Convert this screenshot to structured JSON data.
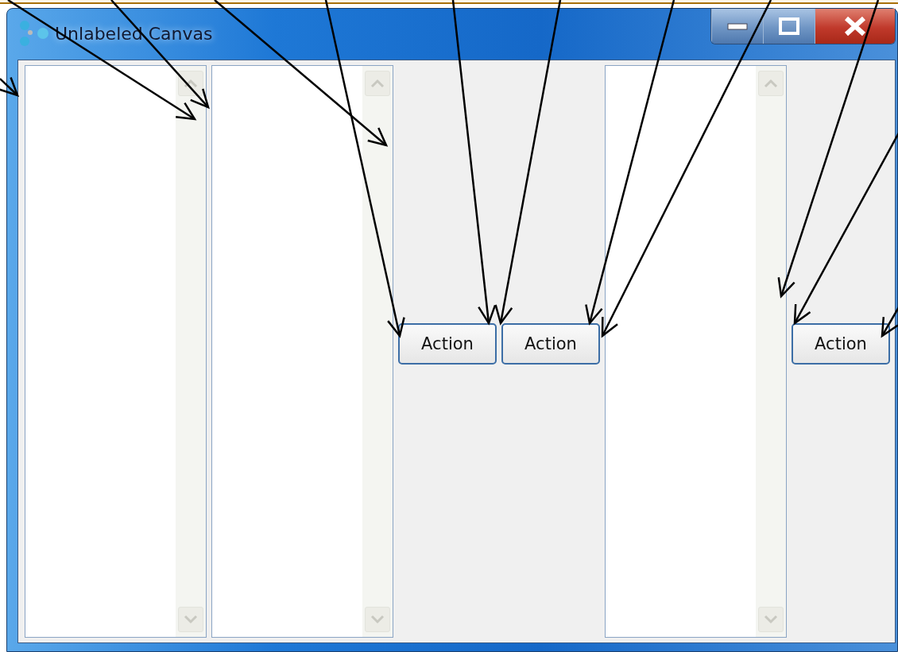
{
  "window": {
    "title": "Unlabeled Canvas"
  },
  "panes": [
    {
      "kind": "list"
    },
    {
      "kind": "list"
    },
    {
      "kind": "buttons",
      "labels": [
        "Action",
        "Action"
      ]
    },
    {
      "kind": "list"
    },
    {
      "kind": "buttons",
      "labels": [
        "Action"
      ]
    }
  ]
}
